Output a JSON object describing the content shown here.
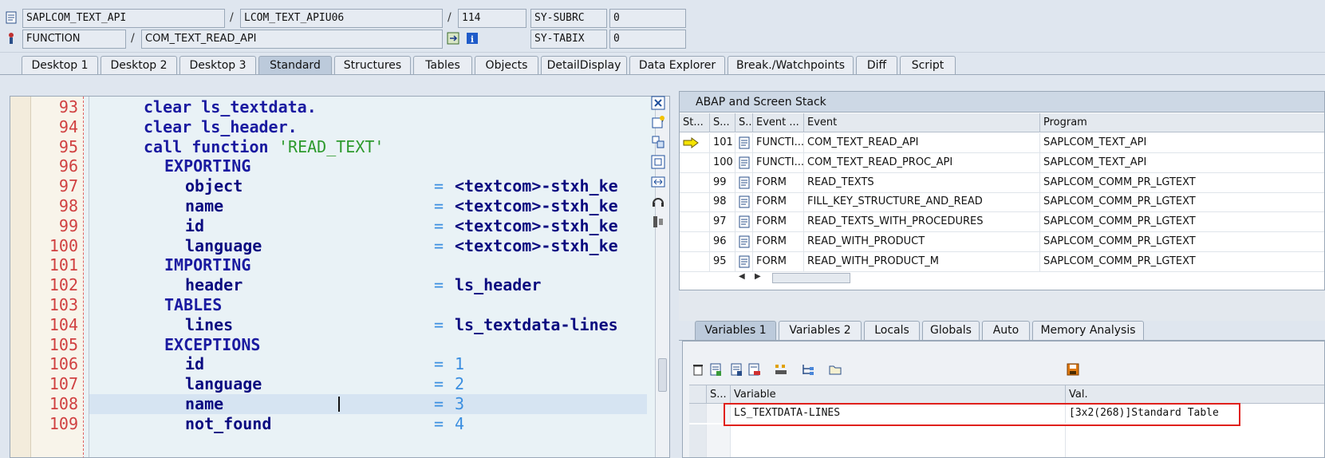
{
  "top": {
    "program": "SAPLCOM_TEXT_API",
    "include": "LCOM_TEXT_APIU06",
    "line": "114",
    "sy_subrc_label": "SY-SUBRC",
    "sy_subrc_value": "0",
    "type": "FUNCTION",
    "event": "COM_TEXT_READ_API",
    "sy_tabix_label": "SY-TABIX",
    "sy_tabix_value": "0",
    "sep1": "/",
    "sep2": "/",
    "sep3": "/"
  },
  "tabs": [
    "Desktop 1",
    "Desktop 2",
    "Desktop 3",
    "Standard",
    "Structures",
    "Tables",
    "Objects",
    "DetailDisplay",
    "Data Explorer",
    "Break./Watchpoints",
    "Diff",
    "Script"
  ],
  "code": {
    "lines": [
      {
        "no": "93",
        "indent": "",
        "kw": "clear ls_textdata.",
        "lhs": "",
        "eq": "",
        "rhs": ""
      },
      {
        "no": "94",
        "indent": "",
        "kw": "clear ls_header.",
        "lhs": "",
        "eq": "",
        "rhs": ""
      },
      {
        "no": "95",
        "indent": "",
        "kw": "call function ",
        "str": "'READ_TEXT'",
        "lhs": "",
        "eq": "",
        "rhs": ""
      },
      {
        "no": "96",
        "indent": "  ",
        "kw": "EXPORTING",
        "lhs": "",
        "eq": "",
        "rhs": ""
      },
      {
        "no": "97",
        "indent": "    ",
        "kw": "",
        "lhs": "object",
        "eq": "=",
        "rhs": "<textcom>-stxh_ke"
      },
      {
        "no": "98",
        "indent": "    ",
        "kw": "",
        "lhs": "name",
        "eq": "=",
        "rhs": "<textcom>-stxh_ke"
      },
      {
        "no": "99",
        "indent": "    ",
        "kw": "",
        "lhs": "id",
        "eq": "=",
        "rhs": "<textcom>-stxh_ke"
      },
      {
        "no": "100",
        "indent": "    ",
        "kw": "",
        "lhs": "language",
        "eq": "=",
        "rhs": "<textcom>-stxh_ke"
      },
      {
        "no": "101",
        "indent": "  ",
        "kw": "IMPORTING",
        "lhs": "",
        "eq": "",
        "rhs": ""
      },
      {
        "no": "102",
        "indent": "    ",
        "kw": "",
        "lhs": "header",
        "eq": "=",
        "rhs": "ls_header"
      },
      {
        "no": "103",
        "indent": "  ",
        "kw": "TABLES",
        "lhs": "",
        "eq": "",
        "rhs": ""
      },
      {
        "no": "104",
        "indent": "    ",
        "kw": "",
        "lhs": "lines",
        "eq": "=",
        "rhs": "ls_textdata-lines"
      },
      {
        "no": "105",
        "indent": "  ",
        "kw": "EXCEPTIONS",
        "lhs": "",
        "eq": "",
        "rhs": ""
      },
      {
        "no": "106",
        "indent": "    ",
        "kw": "",
        "lhs": "id",
        "eq": "=",
        "num": "1"
      },
      {
        "no": "107",
        "indent": "    ",
        "kw": "",
        "lhs": "language",
        "eq": "=",
        "num": "2"
      },
      {
        "no": "108",
        "indent": "    ",
        "kw": "",
        "lhs": "name",
        "eq": "=",
        "num": "3"
      },
      {
        "no": "109",
        "indent": "    ",
        "kw": "",
        "lhs": "not_found",
        "eq": "=",
        "num": "4"
      }
    ]
  },
  "stack": {
    "title": "ABAP and Screen Stack",
    "headers": [
      "St...",
      "S...",
      "S...",
      "Event ...",
      "Event",
      "Program"
    ],
    "rows": [
      {
        "active": true,
        "level": "101",
        "etype": "FUNCTI...",
        "event": "COM_TEXT_READ_API",
        "program": "SAPLCOM_TEXT_API"
      },
      {
        "active": false,
        "level": "100",
        "etype": "FUNCTI...",
        "event": "COM_TEXT_READ_PROC_API",
        "program": "SAPLCOM_TEXT_API"
      },
      {
        "active": false,
        "level": "99",
        "etype": "FORM",
        "event": "READ_TEXTS",
        "program": "SAPLCOM_COMM_PR_LGTEXT"
      },
      {
        "active": false,
        "level": "98",
        "etype": "FORM",
        "event": "FILL_KEY_STRUCTURE_AND_READ",
        "program": "SAPLCOM_COMM_PR_LGTEXT"
      },
      {
        "active": false,
        "level": "97",
        "etype": "FORM",
        "event": "READ_TEXTS_WITH_PROCEDURES",
        "program": "SAPLCOM_COMM_PR_LGTEXT"
      },
      {
        "active": false,
        "level": "96",
        "etype": "FORM",
        "event": "READ_WITH_PRODUCT",
        "program": "SAPLCOM_COMM_PR_LGTEXT"
      },
      {
        "active": false,
        "level": "95",
        "etype": "FORM",
        "event": "READ_WITH_PRODUCT_M",
        "program": "SAPLCOM_COMM_PR_LGTEXT"
      }
    ]
  },
  "vartabs": [
    "Variables 1",
    "Variables 2",
    "Locals",
    "Globals",
    "Auto",
    "Memory Analysis"
  ],
  "vars": {
    "headers": [
      "S...",
      "Variable",
      "Val."
    ],
    "variable": "LS_TEXTDATA-LINES",
    "value": "[3x2(268)]Standard Table"
  },
  "colors": {
    "highlight": "#e0201c",
    "keyword": "#1a1aa0",
    "string": "#2d9a2d",
    "number": "#3a8ee0"
  }
}
